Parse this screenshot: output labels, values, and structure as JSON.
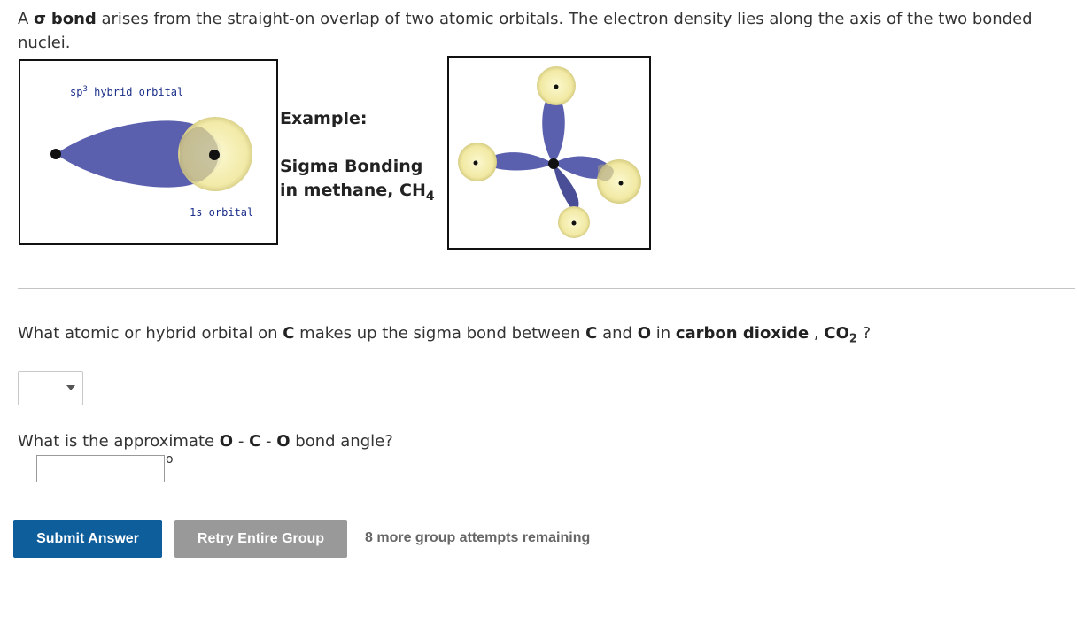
{
  "intro": {
    "prefix": "A ",
    "sigma_symbol": "σ",
    "bold_term": "bond",
    "rest": " arises from the straight-on overlap of two atomic orbitals. The electron density lies along the axis of the two bonded nuclei."
  },
  "figure1": {
    "sp3_label_prefix": "sp",
    "sp3_label_sup": "3",
    "sp3_label_suffix": " hybrid orbital",
    "s_label": "1s orbital"
  },
  "example": {
    "title": "Example:",
    "line1": "Sigma Bonding",
    "line2_prefix": "in methane, CH",
    "line2_sub": "4"
  },
  "question1": {
    "part1": "What atomic or hybrid orbital on ",
    "c1": "C",
    "part2": " makes up the sigma bond between ",
    "c2": "C",
    "part3": " and ",
    "o1": "O",
    "part4": " in ",
    "compound": "carbon dioxide",
    "part5": " , ",
    "formula_prefix": "CO",
    "formula_sub": "2",
    "part6": " ?"
  },
  "select": {
    "value": ""
  },
  "question2": {
    "part1": "What is the approximate ",
    "o1": "O",
    "sep1": " - ",
    "c": "C",
    "sep2": " - ",
    "o2": "O",
    "part2": " bond angle?"
  },
  "angle_input": {
    "value": "",
    "unit": "o"
  },
  "buttons": {
    "submit": "Submit Answer",
    "retry": "Retry Entire Group"
  },
  "attempts_text": "8 more group attempts remaining",
  "colors": {
    "orbital_lobe": "#5a5fae",
    "s_orbital": "#f3eda9",
    "submit_bg": "#0f5e9c",
    "retry_bg": "#999999"
  }
}
